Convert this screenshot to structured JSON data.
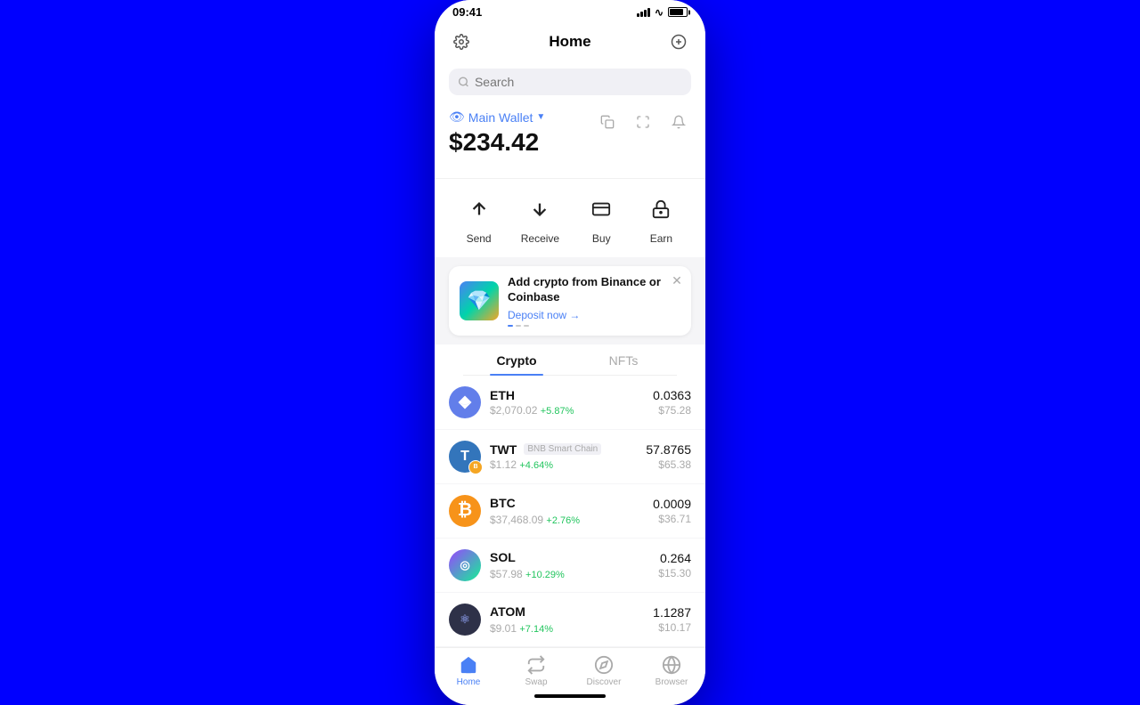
{
  "statusBar": {
    "time": "09:41"
  },
  "header": {
    "title": "Home"
  },
  "search": {
    "placeholder": "Search"
  },
  "wallet": {
    "name": "Main Wallet",
    "balance": "$234.42"
  },
  "actions": [
    {
      "id": "send",
      "label": "Send",
      "icon": "↑"
    },
    {
      "id": "receive",
      "label": "Receive",
      "icon": "↓"
    },
    {
      "id": "buy",
      "label": "Buy",
      "icon": "▤"
    },
    {
      "id": "earn",
      "label": "Earn",
      "icon": "🔒"
    }
  ],
  "banner": {
    "title": "Add crypto from Binance or Coinbase",
    "link": "Deposit now →"
  },
  "tabs": [
    {
      "id": "crypto",
      "label": "Crypto",
      "active": true
    },
    {
      "id": "nfts",
      "label": "NFTs",
      "active": false
    }
  ],
  "assets": [
    {
      "symbol": "ETH",
      "network": "",
      "price": "$2,070.02",
      "change": "+5.87%",
      "changeType": "pos",
      "amount": "0.0363",
      "usdValue": "$75.28",
      "iconType": "eth"
    },
    {
      "symbol": "TWT",
      "network": "BNB Smart Chain",
      "price": "$1.12",
      "change": "+4.64%",
      "changeType": "pos",
      "amount": "57.8765",
      "usdValue": "$65.38",
      "iconType": "twt"
    },
    {
      "symbol": "BTC",
      "network": "",
      "price": "$37,468.09",
      "change": "+2.76%",
      "changeType": "pos",
      "amount": "0.0009",
      "usdValue": "$36.71",
      "iconType": "btc"
    },
    {
      "symbol": "SOL",
      "network": "",
      "price": "$57.98",
      "change": "+10.29%",
      "changeType": "pos",
      "amount": "0.264",
      "usdValue": "$15.30",
      "iconType": "sol"
    },
    {
      "symbol": "ATOM",
      "network": "",
      "price": "$9.01",
      "change": "+7.14%",
      "changeType": "pos",
      "amount": "1.1287",
      "usdValue": "$10.17",
      "iconType": "atom"
    }
  ],
  "bottomNav": [
    {
      "id": "home",
      "label": "Home",
      "active": true
    },
    {
      "id": "swap",
      "label": "Swap",
      "active": false
    },
    {
      "id": "discover",
      "label": "Discover",
      "active": false
    },
    {
      "id": "browser",
      "label": "Browser",
      "active": false
    }
  ]
}
